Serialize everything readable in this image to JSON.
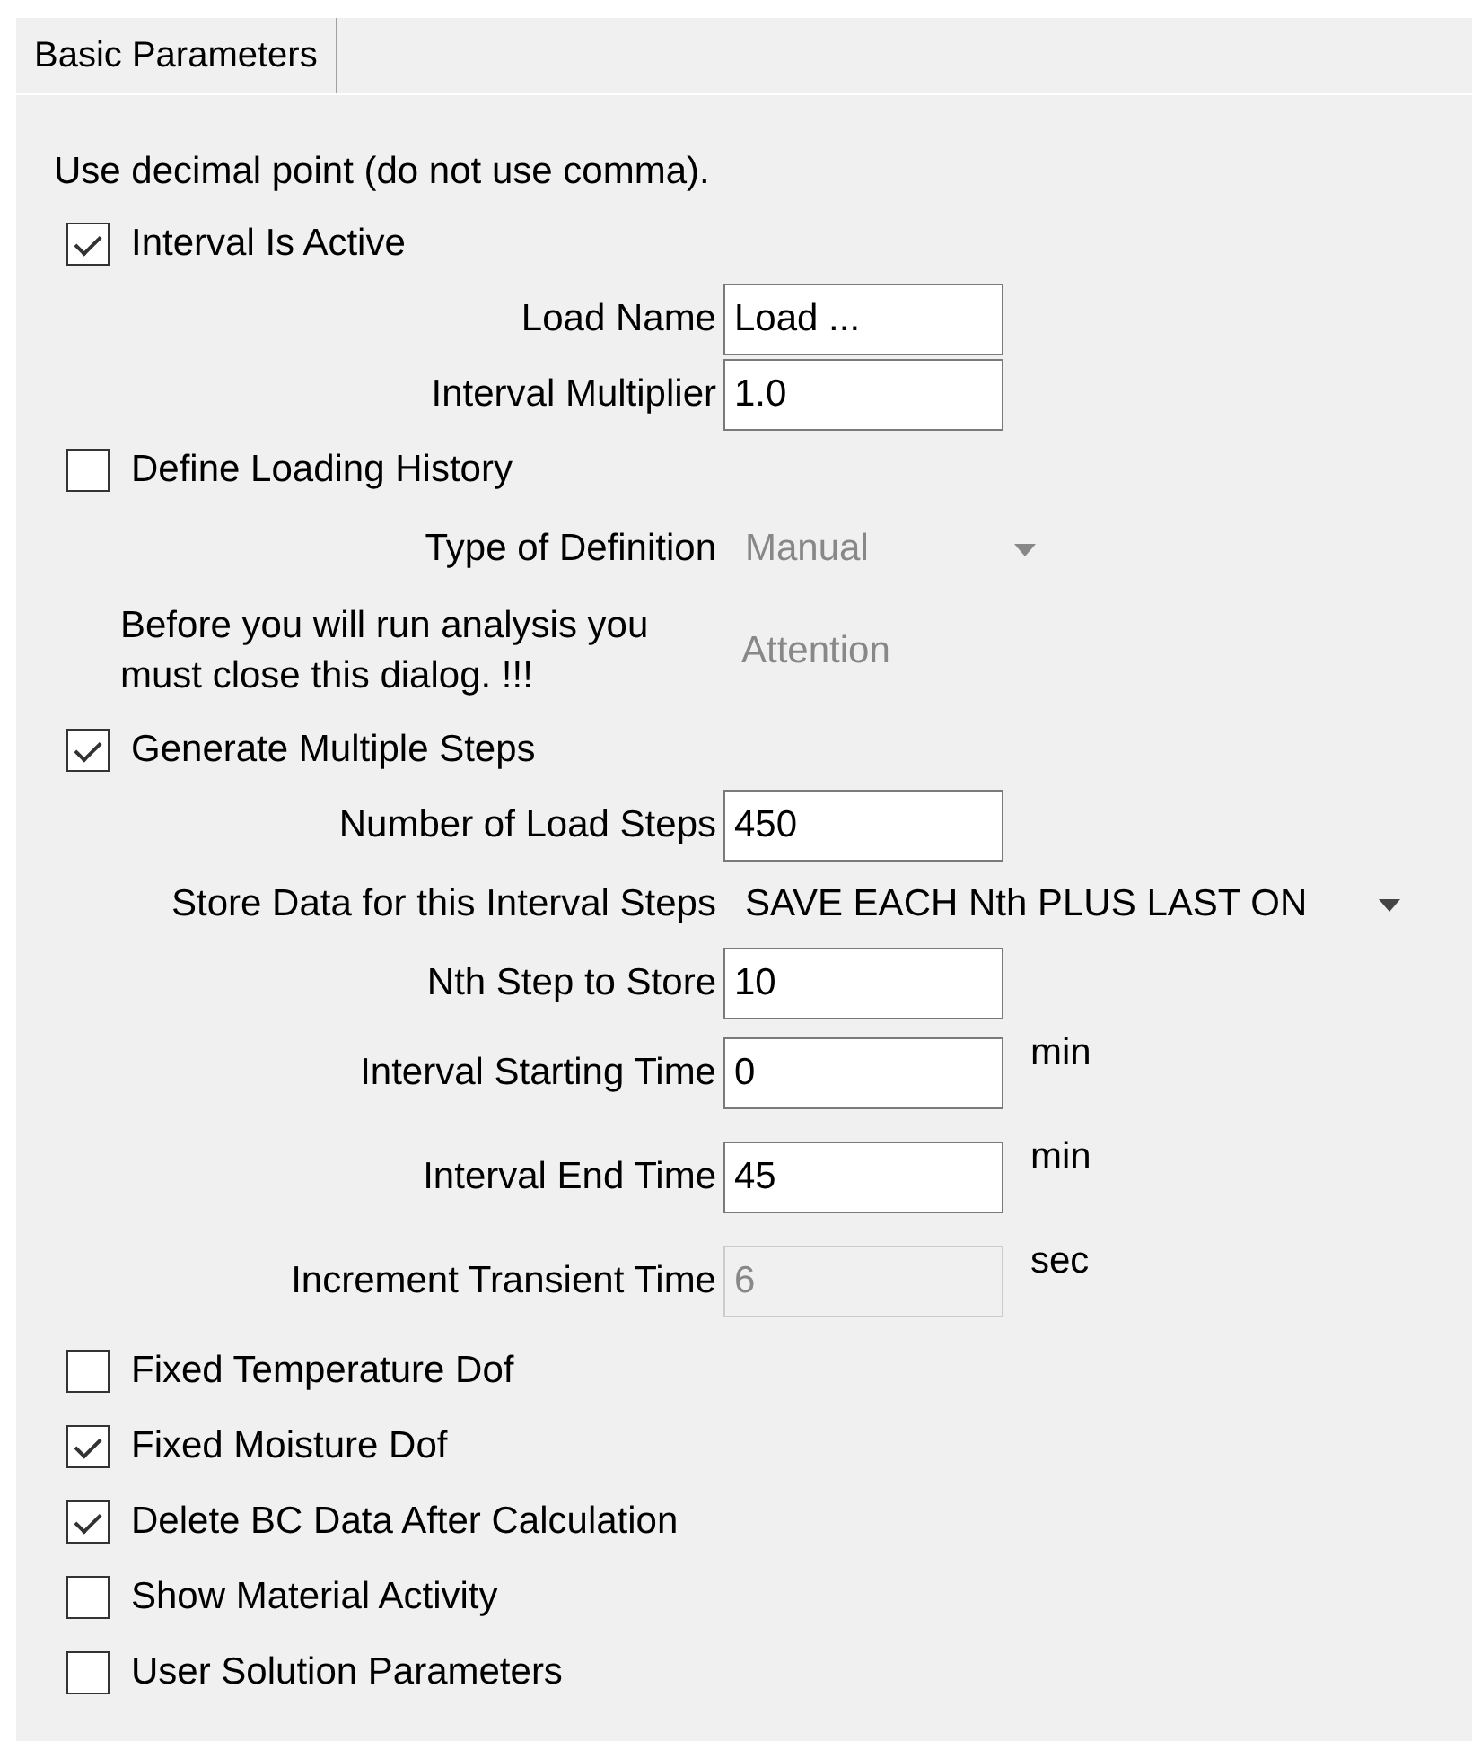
{
  "tabs": [
    {
      "label": "Basic Parameters",
      "selected": true
    }
  ],
  "rows": [
    {
      "kind": "note",
      "text": "Use decimal point (do not use comma)."
    },
    {
      "kind": "checkbox",
      "label": "Interval Is Active",
      "checked": true
    },
    {
      "kind": "field",
      "label": "Load Name",
      "value": "Load ...",
      "disabled": false
    },
    {
      "kind": "field",
      "label": "Interval Multiplier",
      "value": "1.0",
      "disabled": false
    },
    {
      "kind": "checkbox",
      "label": "Define Loading History",
      "checked": false
    },
    {
      "kind": "dropdown",
      "label": "Type of Definition",
      "value": "Manual",
      "disabled": true
    },
    {
      "kind": "static",
      "label": "Before you will run analysis you must close this dialog. !!!",
      "value": "Attention",
      "disabled": true
    },
    {
      "kind": "checkbox",
      "label": "Generate Multiple Steps",
      "checked": true
    },
    {
      "kind": "field",
      "label": "Number of Load Steps",
      "value": "450",
      "disabled": false
    },
    {
      "kind": "dropdown",
      "label": "Store Data for this Interval Steps",
      "value": "SAVE EACH Nth PLUS LAST ON",
      "disabled": false
    },
    {
      "kind": "field",
      "label": "Nth Step to Store",
      "value": "10",
      "disabled": false
    },
    {
      "kind": "field",
      "label": "Interval Starting Time",
      "value": "0",
      "unit": "min",
      "disabled": false
    },
    {
      "kind": "field",
      "label": "Interval End Time",
      "value": "45",
      "unit": "min",
      "disabled": false
    },
    {
      "kind": "field",
      "label": "Increment Transient Time",
      "value": "6",
      "unit": "sec",
      "disabled": true
    },
    {
      "kind": "checkbox",
      "label": "Fixed Temperature Dof",
      "checked": false
    },
    {
      "kind": "checkbox",
      "label": "Fixed Moisture Dof",
      "checked": true
    },
    {
      "kind": "checkbox",
      "label": "Delete BC Data After Calculation",
      "checked": true
    },
    {
      "kind": "checkbox",
      "label": "Show Material Activity",
      "checked": false
    },
    {
      "kind": "checkbox",
      "label": "User Solution Parameters",
      "checked": false
    }
  ]
}
